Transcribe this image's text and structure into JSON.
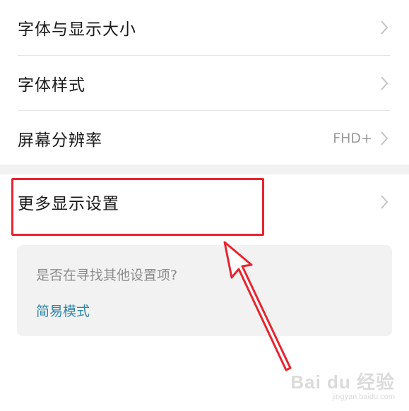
{
  "settings": {
    "items": [
      {
        "label": "字体与显示大小",
        "value": ""
      },
      {
        "label": "字体样式",
        "value": ""
      },
      {
        "label": "屏幕分辨率",
        "value": "FHD+"
      },
      {
        "label": "更多显示设置",
        "value": ""
      }
    ]
  },
  "help": {
    "question": "是否在寻找其他设置项?",
    "link_label": "简易模式"
  },
  "annotation": {
    "highlight_color": "#e8242f"
  },
  "watermark": {
    "brand": "Bai du 经验",
    "url": "jingyan.baidu.com"
  },
  "colors": {
    "text_primary": "#1a1a1a",
    "text_secondary": "#9a9a9a",
    "link": "#2e86a8",
    "card_bg": "#f2f2f2"
  }
}
